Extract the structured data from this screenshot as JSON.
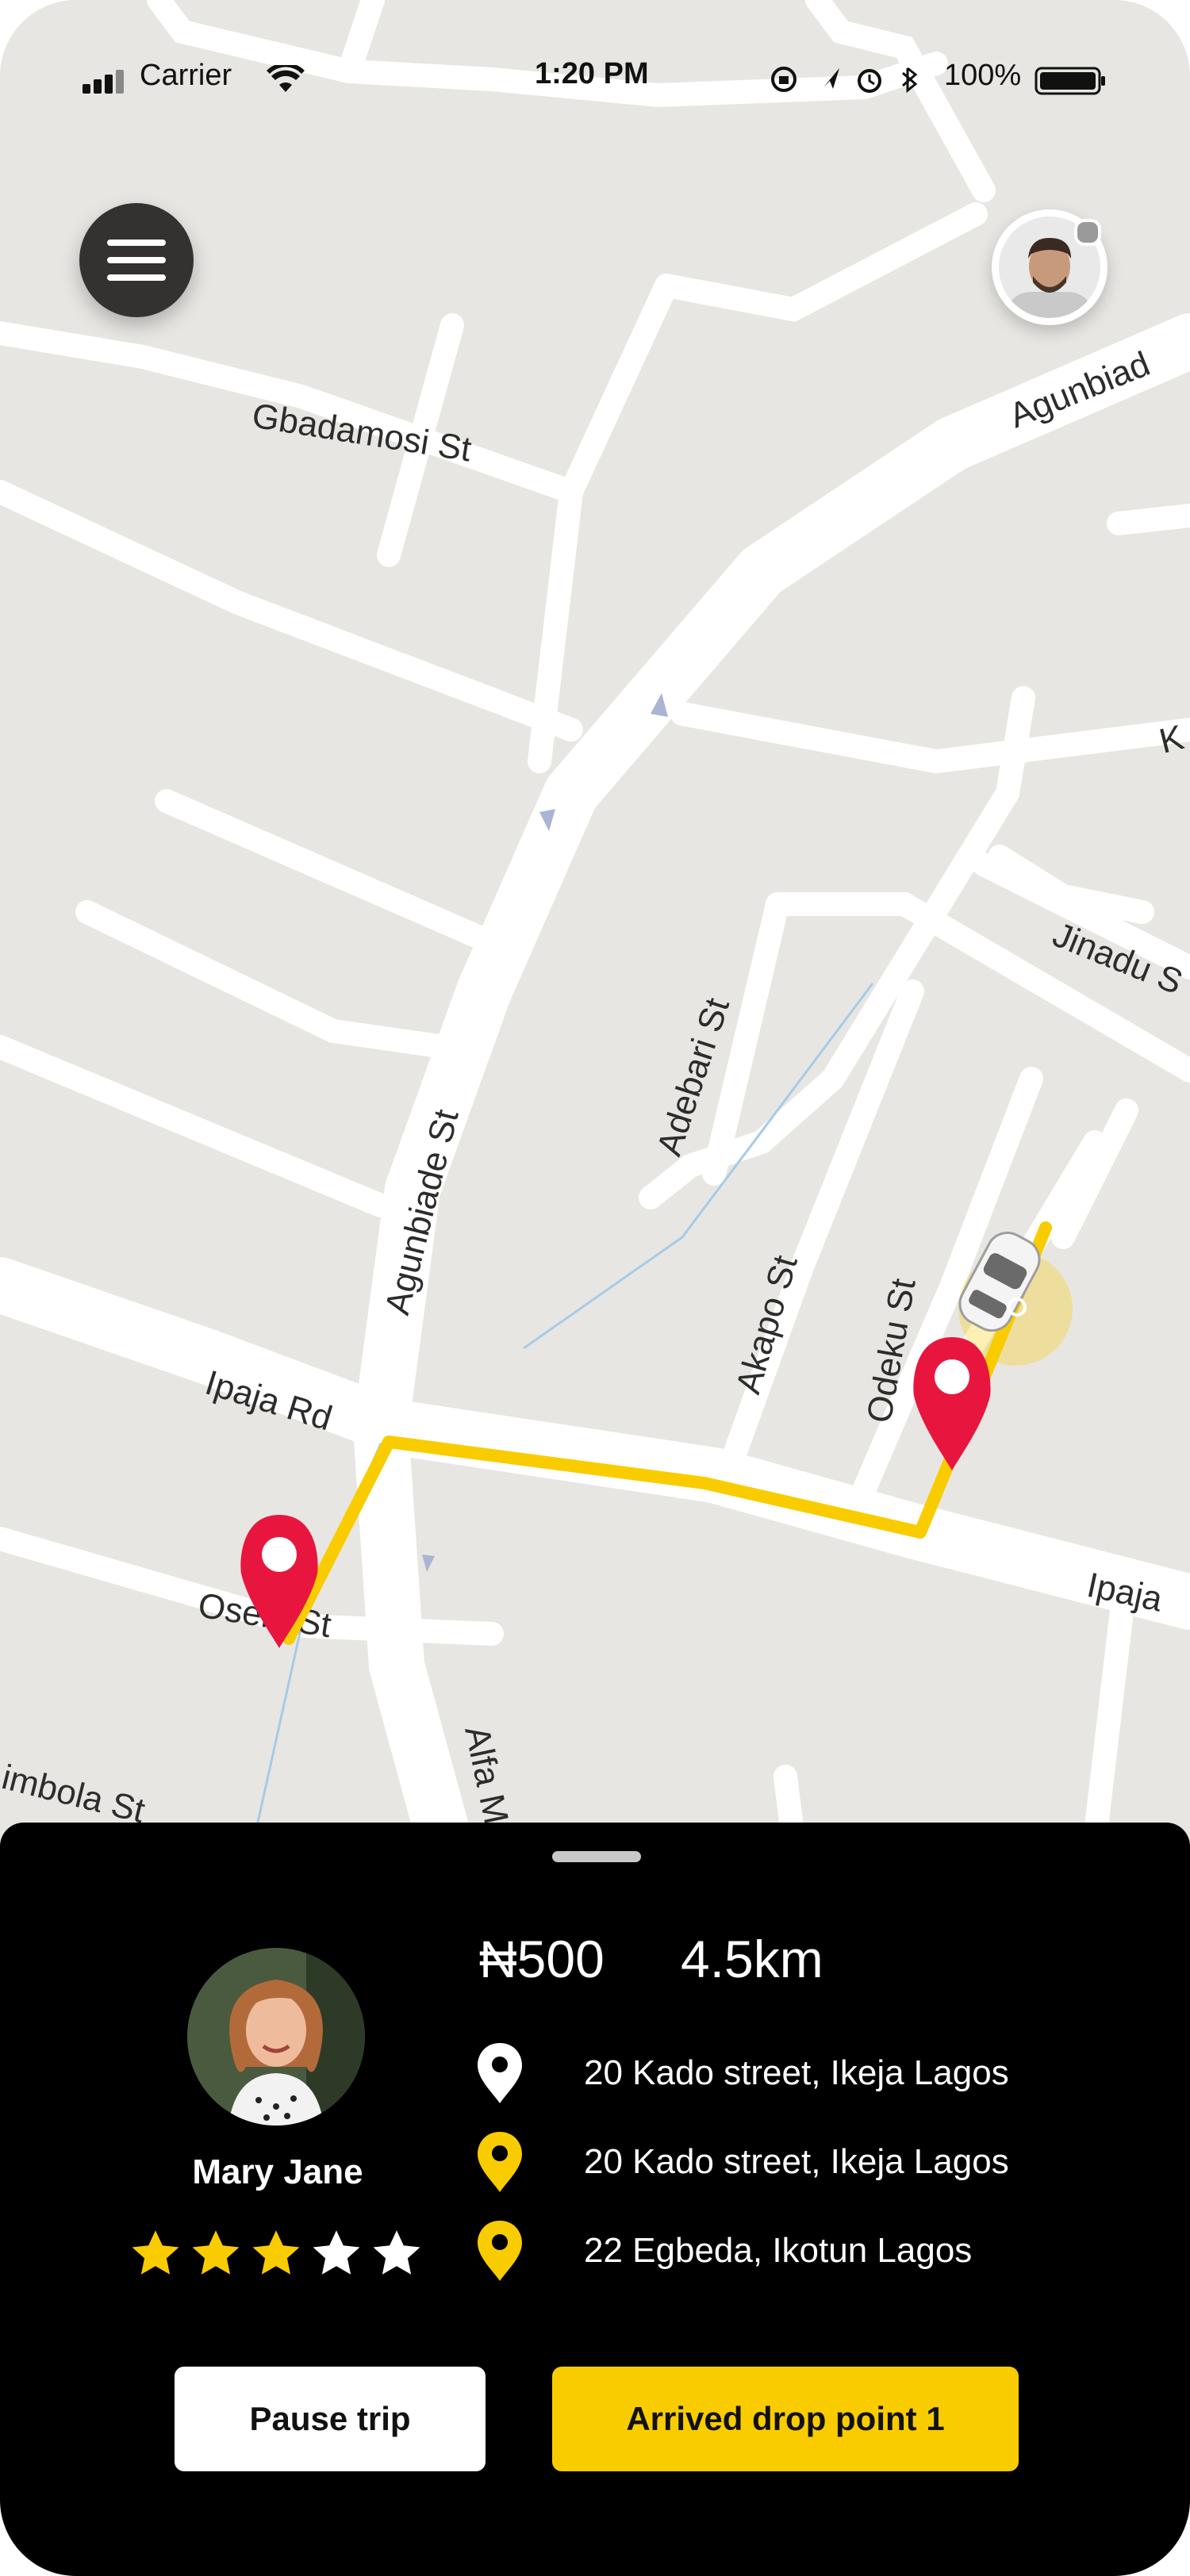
{
  "status_bar": {
    "carrier": "Carrier",
    "time": "1:20 PM",
    "battery": "100%"
  },
  "map": {
    "street_labels": [
      "Gbadamosi St",
      "Agunbiade St",
      "Agunbiad",
      "K",
      "Jinadu S",
      "Adebari St",
      "Akapo St",
      "Odeku St",
      "Ipaja Rd",
      "Ipaja",
      "Oseni St",
      "imbola St",
      "Alfa M"
    ],
    "route_color": "#f9cc00",
    "pin_color": "#e8163e"
  },
  "trip": {
    "fare": "₦500",
    "distance": "4.5km",
    "rider_name": "Mary Jane",
    "rating": 3,
    "rating_max": 5,
    "stops": [
      {
        "address": "20 Kado street, Ikeja Lagos",
        "icon": "location-pin-white-icon"
      },
      {
        "address": "20 Kado street, Ikeja Lagos",
        "icon": "location-pin-yellow-icon"
      },
      {
        "address": "22 Egbeda, Ikotun Lagos",
        "icon": "location-pin-yellow-icon"
      }
    ]
  },
  "actions": {
    "pause_label": "Pause trip",
    "arrived_label": "Arrived drop point 1"
  },
  "colors": {
    "accent": "#f9cc00",
    "sheet_bg": "#000000",
    "map_bg": "#e8e6e3"
  }
}
